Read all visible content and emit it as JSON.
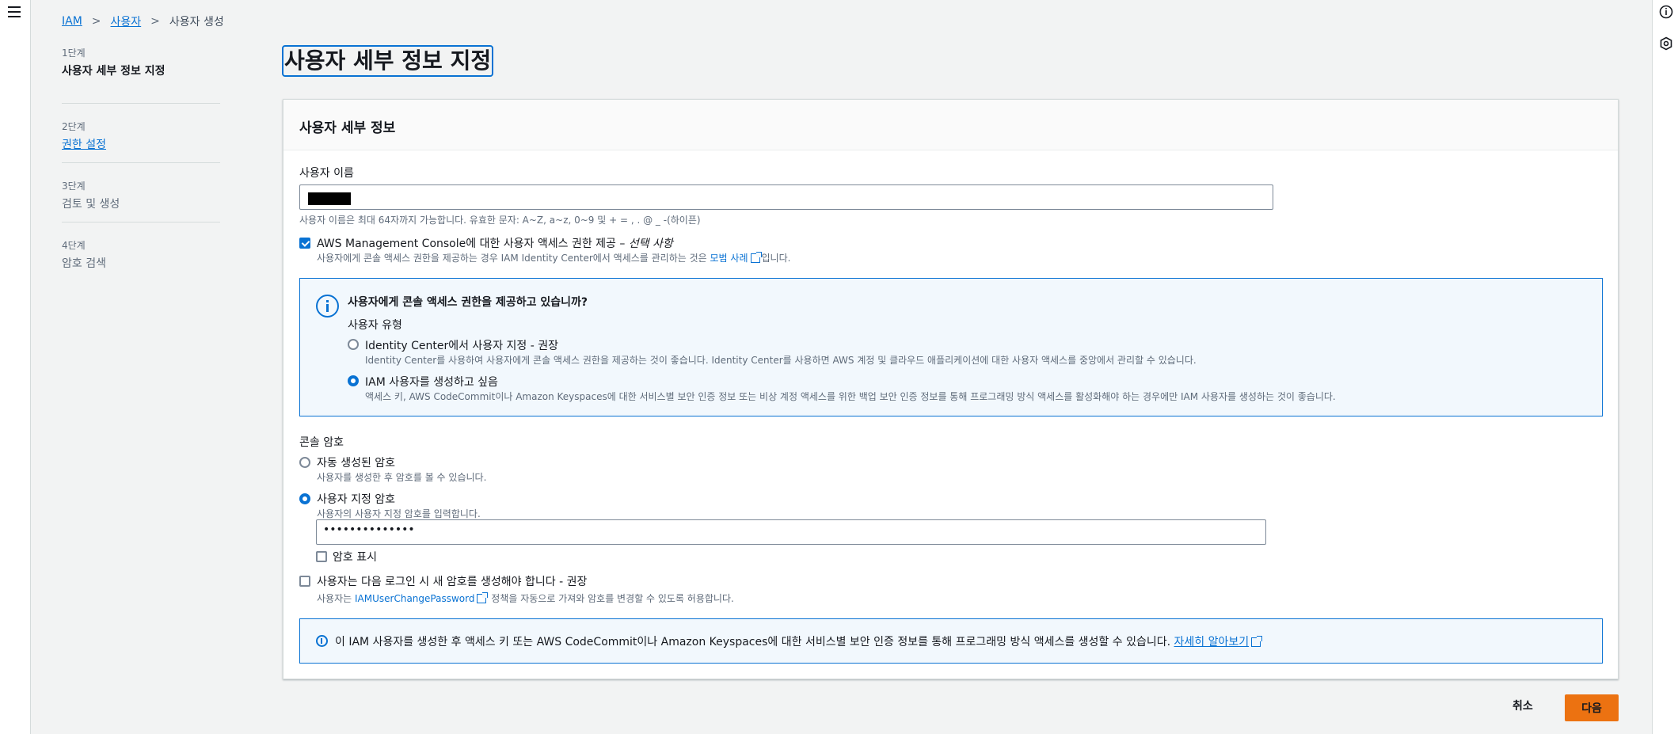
{
  "breadcrumb": {
    "iam": "IAM",
    "users": "사용자",
    "current": "사용자 생성"
  },
  "steps": [
    {
      "num": "1단계",
      "title": "사용자 세부 정보 지정"
    },
    {
      "num": "2단계",
      "title": "권한 설정"
    },
    {
      "num": "3단계",
      "title": "검토 및 생성"
    },
    {
      "num": "4단계",
      "title": "암호 검색"
    }
  ],
  "page_title": "사용자 세부 정보 지정",
  "panel": {
    "header": "사용자 세부 정보",
    "username_label": "사용자 이름",
    "username_hint": "사용자 이름은 최대 64자까지 가능합니다. 유효한 문자: A~Z, a~z, 0~9 및 + = , . @ _ -(하이픈)",
    "console_access_label": "AWS Management Console에 대한 사용자 액세스 권한 제공 –",
    "console_access_optional": "선택 사항",
    "console_access_desc_pre": "사용자에게 콘솔 액세스 권한을 제공하는 경우 IAM Identity Center에서 액세스를 관리하는 것은",
    "console_access_desc_link": "모범 사례",
    "console_access_desc_post": "입니다.",
    "info_question": "사용자에게 콘솔 액세스 권한을 제공하고 있습니까?",
    "user_type_label": "사용자 유형",
    "opt_identity_center_title": "Identity Center에서 사용자 지정 - 권장",
    "opt_identity_center_desc": "Identity Center를 사용하여 사용자에게 콘솔 액세스 권한을 제공하는 것이 좋습니다. Identity Center를 사용하면 AWS 계정 및 클라우드 애플리케이션에 대한 사용자 액세스를 중앙에서 관리할 수 있습니다.",
    "opt_iam_user_title": "IAM 사용자를 생성하고 싶음",
    "opt_iam_user_desc": "액세스 키, AWS CodeCommit이나 Amazon Keyspaces에 대한 서비스별 보안 인증 정보 또는 비상 계정 액세스를 위한 백업 보안 인증 정보를 통해 프로그래밍 방식 액세스를 활성화해야 하는 경우에만 IAM 사용자를 생성하는 것이 좋습니다.",
    "console_password_label": "콘솔 암호",
    "auto_pw_title": "자동 생성된 암호",
    "auto_pw_desc": "사용자를 생성한 후 암호를 볼 수 있습니다.",
    "custom_pw_title": "사용자 지정 암호",
    "custom_pw_desc": "사용자의 사용자 지정 암호를 입력합니다.",
    "custom_pw_value": "••••••••••••••",
    "show_pw_label": "암호 표시",
    "reset_pw_label": "사용자는 다음 로그인 시 새 암호를 생성해야 합니다 - 권장",
    "reset_pw_desc_pre": "사용자는",
    "reset_pw_desc_link": "IAMUserChangePassword",
    "reset_pw_desc_post": "정책을 자동으로 가져와 암호를 변경할 수 있도록 허용합니다.",
    "bottom_info_text": "이 IAM 사용자를 생성한 후 액세스 키 또는 AWS CodeCommit이나 Amazon Keyspaces에 대한 서비스별 보안 인증 정보를 통해 프로그래밍 방식 액세스를 생성할 수 있습니다.",
    "bottom_info_link": "자세히 알아보기"
  },
  "footer": {
    "cancel": "취소",
    "next": "다음"
  },
  "colors": {
    "accent": "#0972d3",
    "primary_button": "#ec7211"
  }
}
